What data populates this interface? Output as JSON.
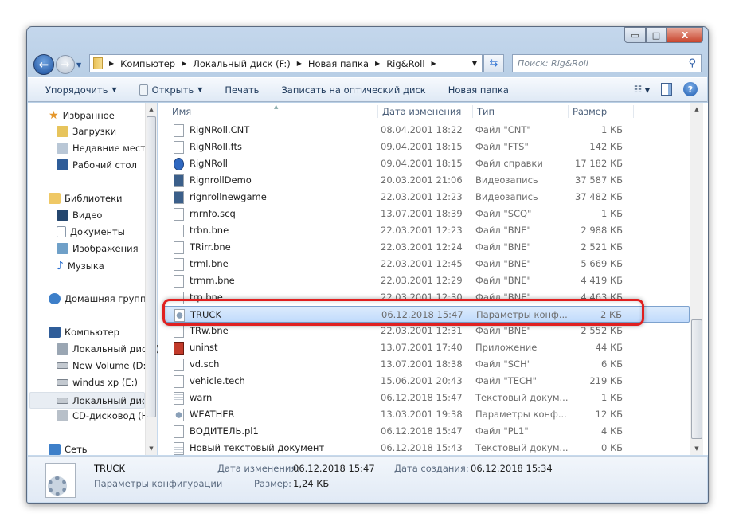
{
  "window": {
    "minimize": "▭",
    "maximize": "□",
    "close": "X"
  },
  "address": {
    "crumbs": [
      "Компьютер",
      "Локальный диск (F:)",
      "Новая папка",
      "Rig&Roll"
    ],
    "search_placeholder": "Поиск: Rig&Roll"
  },
  "toolbar": {
    "organize": "Упорядочить",
    "open": "Открыть",
    "print": "Печать",
    "burn": "Записать на оптический диск",
    "new_folder": "Новая папка"
  },
  "nav": {
    "favorites": "Избранное",
    "downloads": "Загрузки",
    "recent": "Недавние места",
    "desktop": "Рабочий стол",
    "libraries": "Библиотеки",
    "video": "Видео",
    "documents": "Документы",
    "pictures": "Изображения",
    "music": "Музыка",
    "homegroup": "Домашняя группа",
    "computer": "Компьютер",
    "drive_c": "Локальный диск (C:)",
    "drive_d": "New Volume (D:)",
    "drive_e": "windus xp (E:)",
    "drive_f": "Локальный диск (F:)",
    "drive_h": "CD-дисковод (H:)",
    "network": "Сеть"
  },
  "columns": {
    "name": "Имя",
    "date": "Дата изменения",
    "type": "Тип",
    "size": "Размер"
  },
  "files": [
    {
      "name": "RigNRoll.CNT",
      "date": "08.04.2001 18:22",
      "type": "Файл \"CNT\"",
      "size": "1 КБ",
      "icon": "file"
    },
    {
      "name": "RigNRoll.fts",
      "date": "09.04.2001 18:15",
      "type": "Файл \"FTS\"",
      "size": "142 КБ",
      "icon": "file"
    },
    {
      "name": "RigNRoll",
      "date": "09.04.2001 18:15",
      "type": "Файл справки",
      "size": "17 182 КБ",
      "icon": "help"
    },
    {
      "name": "RignrollDemo",
      "date": "20.03.2001 21:06",
      "type": "Видеозапись",
      "size": "37 587 КБ",
      "icon": "video"
    },
    {
      "name": "rignrollnewgame",
      "date": "22.03.2001 12:23",
      "type": "Видеозапись",
      "size": "37 482 КБ",
      "icon": "video"
    },
    {
      "name": "rnrnfo.scq",
      "date": "13.07.2001 18:39",
      "type": "Файл \"SCQ\"",
      "size": "1 КБ",
      "icon": "file"
    },
    {
      "name": "trbn.bne",
      "date": "22.03.2001 12:23",
      "type": "Файл \"BNE\"",
      "size": "2 988 КБ",
      "icon": "file"
    },
    {
      "name": "TRirr.bne",
      "date": "22.03.2001 12:24",
      "type": "Файл \"BNE\"",
      "size": "2 521 КБ",
      "icon": "file"
    },
    {
      "name": "trml.bne",
      "date": "22.03.2001 12:45",
      "type": "Файл \"BNE\"",
      "size": "5 669 КБ",
      "icon": "file"
    },
    {
      "name": "trmm.bne",
      "date": "22.03.2001 12:29",
      "type": "Файл \"BNE\"",
      "size": "4 419 КБ",
      "icon": "file"
    },
    {
      "name": "trp.bne",
      "date": "22.03.2001 12:30",
      "type": "Файл \"BNE\"",
      "size": "4 463 КБ",
      "icon": "file"
    },
    {
      "name": "TRUCK",
      "date": "06.12.2018 15:47",
      "type": "Параметры конф...",
      "size": "2 КБ",
      "icon": "config"
    },
    {
      "name": "TRw.bne",
      "date": "22.03.2001 12:31",
      "type": "Файл \"BNE\"",
      "size": "2 552 КБ",
      "icon": "file"
    },
    {
      "name": "uninst",
      "date": "13.07.2001 17:40",
      "type": "Приложение",
      "size": "44 КБ",
      "icon": "app"
    },
    {
      "name": "vd.sch",
      "date": "13.07.2001 18:38",
      "type": "Файл \"SCH\"",
      "size": "6 КБ",
      "icon": "file"
    },
    {
      "name": "vehicle.tech",
      "date": "15.06.2001 20:43",
      "type": "Файл \"TECH\"",
      "size": "219 КБ",
      "icon": "file"
    },
    {
      "name": "warn",
      "date": "06.12.2018 15:47",
      "type": "Текстовый докум...",
      "size": "1 КБ",
      "icon": "text"
    },
    {
      "name": "WEATHER",
      "date": "13.03.2001 19:38",
      "type": "Параметры конф...",
      "size": "12 КБ",
      "icon": "config"
    },
    {
      "name": "ВОДИТЕЛЬ.pl1",
      "date": "06.12.2018 15:47",
      "type": "Файл \"PL1\"",
      "size": "4 КБ",
      "icon": "file"
    },
    {
      "name": "Новый текстовый документ",
      "date": "06.12.2018 15:43",
      "type": "Текстовый докум...",
      "size": "0 КБ",
      "icon": "text"
    }
  ],
  "selected_index": 11,
  "status": {
    "name": "TRUCK",
    "type": "Параметры конфигурации",
    "modified_label": "Дата изменения:",
    "modified": "06.12.2018 15:47",
    "size_label": "Размер:",
    "size": "1,24 КБ",
    "created_label": "Дата создания:",
    "created": "06.12.2018 15:34"
  },
  "colors": {
    "highlight": "#e02020",
    "selection": "#c1dbfc"
  }
}
